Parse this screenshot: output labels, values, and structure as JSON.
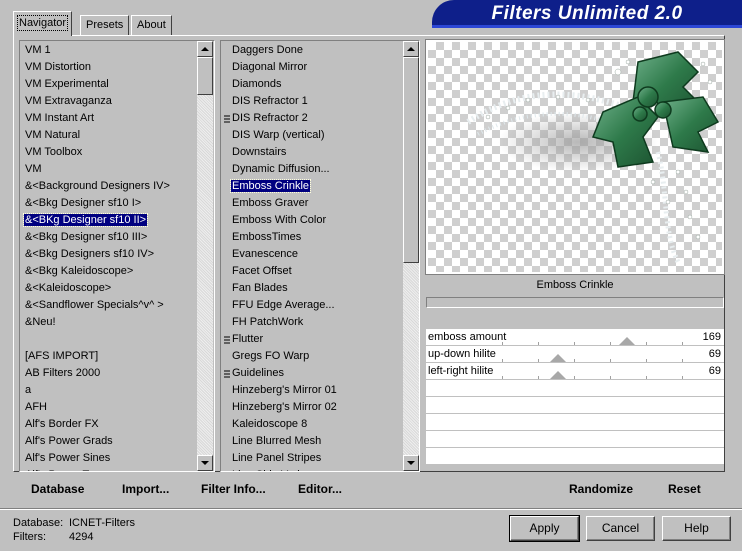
{
  "app": {
    "title": "Filters Unlimited 2.0"
  },
  "tabs": [
    {
      "label": "Navigator",
      "active": true
    },
    {
      "label": "Presets",
      "active": false
    },
    {
      "label": "About",
      "active": false
    }
  ],
  "categories": {
    "items": [
      "VM 1",
      "VM Distortion",
      "VM Experimental",
      "VM Extravaganza",
      "VM Instant Art",
      "VM Natural",
      "VM Toolbox",
      "VM",
      "&<Background Designers IV>",
      "&<Bkg Designer sf10 I>",
      "&<BKg Designer sf10 II>",
      "&<Bkg Designer sf10 III>",
      "&<Bkg Designers sf10 IV>",
      "&<Bkg Kaleidoscope>",
      "&<Kaleidoscope>",
      "&<Sandflower Specials^v^ >",
      "&Neu!",
      "",
      "[AFS IMPORT]",
      "AB Filters 2000",
      "a",
      "AFH",
      "Alf's Border FX",
      "Alf's Power Grads",
      "Alf's Power Sines",
      "Alf's Power Toys"
    ],
    "selected_index": 10
  },
  "filters": {
    "items": [
      {
        "label": "Daggers Done",
        "marked": false
      },
      {
        "label": "Diagonal Mirror",
        "marked": false
      },
      {
        "label": "Diamonds",
        "marked": false
      },
      {
        "label": "DIS Refractor 1",
        "marked": false
      },
      {
        "label": "DIS Refractor 2",
        "marked": true
      },
      {
        "label": "DIS Warp (vertical)",
        "marked": false
      },
      {
        "label": "Downstairs",
        "marked": false
      },
      {
        "label": "Dynamic Diffusion...",
        "marked": false
      },
      {
        "label": "Emboss Crinkle",
        "marked": false
      },
      {
        "label": "Emboss Graver",
        "marked": false
      },
      {
        "label": "Emboss With Color",
        "marked": false
      },
      {
        "label": "EmbossTimes",
        "marked": false
      },
      {
        "label": "Evanescence",
        "marked": false
      },
      {
        "label": "Facet Offset",
        "marked": false
      },
      {
        "label": "Fan Blades",
        "marked": false
      },
      {
        "label": "FFU Edge Average...",
        "marked": false
      },
      {
        "label": "FH PatchWork",
        "marked": false
      },
      {
        "label": "Flutter",
        "marked": true
      },
      {
        "label": "Gregs FO Warp",
        "marked": false
      },
      {
        "label": "Guidelines",
        "marked": true
      },
      {
        "label": "Hinzeberg's Mirror 01",
        "marked": false
      },
      {
        "label": "Hinzeberg's Mirror 02",
        "marked": false
      },
      {
        "label": "Kaleidoscope 8",
        "marked": false
      },
      {
        "label": "Line Blurred Mesh",
        "marked": false
      },
      {
        "label": "Line Panel Stripes",
        "marked": false
      },
      {
        "label": "Line Side Variance",
        "marked": false
      }
    ],
    "selected_index": 8
  },
  "preview": {
    "filter_name": "Emboss Crinkle"
  },
  "parameters": [
    {
      "label": "emboss amount",
      "value": "169",
      "level": 169
    },
    {
      "label": "up-down hilite",
      "value": "69",
      "level": 69
    },
    {
      "label": "left-right hilite",
      "value": "69",
      "level": 69
    }
  ],
  "actions": {
    "database": "Database",
    "import": "Import...",
    "filter_info": "Filter Info...",
    "editor": "Editor...",
    "randomize": "Randomize",
    "reset": "Reset"
  },
  "footer": {
    "database_key": "Database:",
    "database_value": "ICNET-Filters",
    "filters_key": "Filters:",
    "filters_value": "4294",
    "apply": "Apply",
    "cancel": "Cancel",
    "help": "Help"
  },
  "colors": {
    "banner_bg": "#0e1f8a",
    "selection": "#000080",
    "holly_leaf": "#2e7a4a"
  }
}
